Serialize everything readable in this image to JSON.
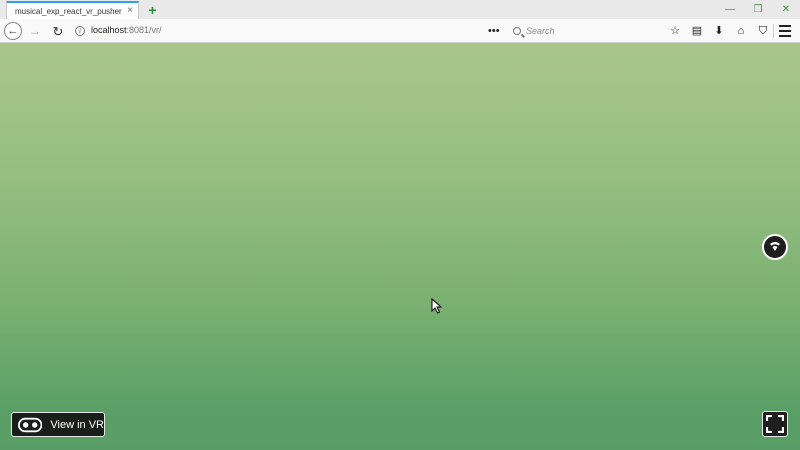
{
  "tab": {
    "title": "musical_exp_react_vr_pusher",
    "close_glyph": "×",
    "new_tab_glyph": "+"
  },
  "window_controls": {
    "minimize_glyph": "—",
    "restore_glyph": "❐",
    "close_glyph": "✕"
  },
  "navbar": {
    "back_glyph": "←",
    "forward_glyph": "→",
    "reload_glyph": "↻",
    "info_glyph": "i",
    "url_host": "localhost",
    "url_rest": ":8081/vr/",
    "page_actions_glyph": "•••",
    "search_placeholder": "Search",
    "icons": [
      {
        "name": "bookmark-star-icon",
        "glyph": "☆"
      },
      {
        "name": "library-icon",
        "glyph": "▤"
      },
      {
        "name": "downloads-icon",
        "glyph": "⬇"
      },
      {
        "name": "home-icon",
        "glyph": "⌂"
      },
      {
        "name": "pocket-shield-icon",
        "glyph": "⛉"
      }
    ]
  },
  "content": {
    "background_top_color": "#a9c68a",
    "background_bottom_color": "#579d65",
    "view_in_vr_label": "View in VR"
  },
  "colors": {
    "tab_accent": "#2f9ef3",
    "new_tab_green": "#2a8a3c",
    "overlay_button_bg": "#1e1e1e"
  }
}
